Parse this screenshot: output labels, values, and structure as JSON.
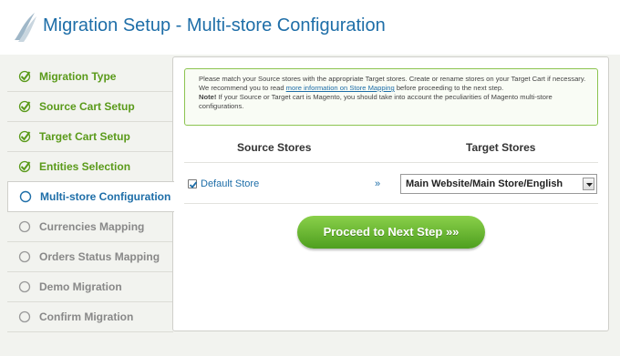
{
  "header": {
    "title": "Migration Setup - Multi-store Configuration"
  },
  "sidebar": {
    "items": [
      {
        "label": "Migration Type",
        "status": "done"
      },
      {
        "label": "Source Cart Setup",
        "status": "done"
      },
      {
        "label": "Target Cart Setup",
        "status": "done"
      },
      {
        "label": "Entities Selection",
        "status": "done"
      },
      {
        "label": "Multi-store Configuration",
        "status": "current"
      },
      {
        "label": "Currencies Mapping",
        "status": "pending"
      },
      {
        "label": "Orders Status Mapping",
        "status": "pending"
      },
      {
        "label": "Demo Migration",
        "status": "pending"
      },
      {
        "label": "Confirm Migration",
        "status": "pending"
      }
    ]
  },
  "notice": {
    "text1": "Please match your Source stores with the appropriate Target stores. Create or rename stores on your Target Cart if necessary. We recommend you to read ",
    "link": "more information on Store Mapping",
    "text2": " before proceeding to the next step.",
    "note_label": "Note!",
    "note_text": " If your Source or Target cart is Magento, you should take into account the peculiarities of Magento multi-store configurations."
  },
  "mapping": {
    "source_header": "Source Stores",
    "target_header": "Target Stores",
    "rows": [
      {
        "source": "Default Store",
        "arrow": "»",
        "target": "Main Website/Main Store/English"
      }
    ]
  },
  "actions": {
    "proceed": "Proceed to Next Step »»"
  },
  "colors": {
    "title_blue": "#1e6ea8",
    "done_green": "#5a9a1a",
    "button_green": "#6cbb32"
  }
}
